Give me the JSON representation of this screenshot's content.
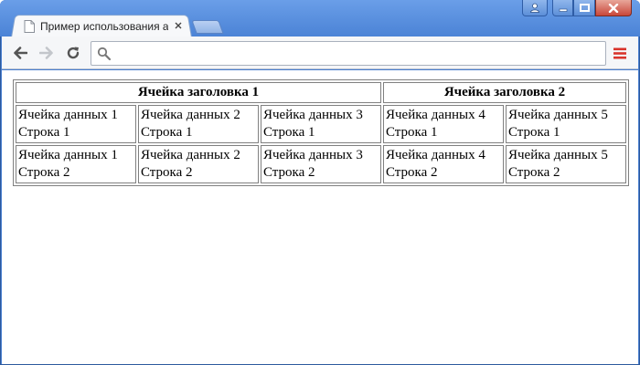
{
  "browser": {
    "tab_title": "Пример использования атрибута colspan",
    "address_value": "",
    "address_placeholder": ""
  },
  "table": {
    "headers": [
      {
        "label": "Ячейка заголовка 1",
        "colspan": 3
      },
      {
        "label": "Ячейка заголовка 2",
        "colspan": 2
      }
    ],
    "rows": [
      {
        "cells": [
          {
            "line1": "Ячейка данных 1",
            "line2": "Строка 1"
          },
          {
            "line1": "Ячейка данных 2",
            "line2": "Строка 1"
          },
          {
            "line1": "Ячейка данных 3",
            "line2": "Строка 1"
          },
          {
            "line1": "Ячейка данных 4",
            "line2": "Строка 1"
          },
          {
            "line1": "Ячейка данных 5",
            "line2": "Строка 1"
          }
        ]
      },
      {
        "cells": [
          {
            "line1": "Ячейка данных 1",
            "line2": "Строка 2"
          },
          {
            "line1": "Ячейка данных 2",
            "line2": "Строка 2"
          },
          {
            "line1": "Ячейка данных 3",
            "line2": "Строка 2"
          },
          {
            "line1": "Ячейка данных 4",
            "line2": "Строка 2"
          },
          {
            "line1": "Ячейка данных 5",
            "line2": "Строка 2"
          }
        ]
      }
    ]
  },
  "colors": {
    "frame": "#4a7fd0",
    "menu_accent": "#d9342b",
    "table_border": "#808080"
  }
}
